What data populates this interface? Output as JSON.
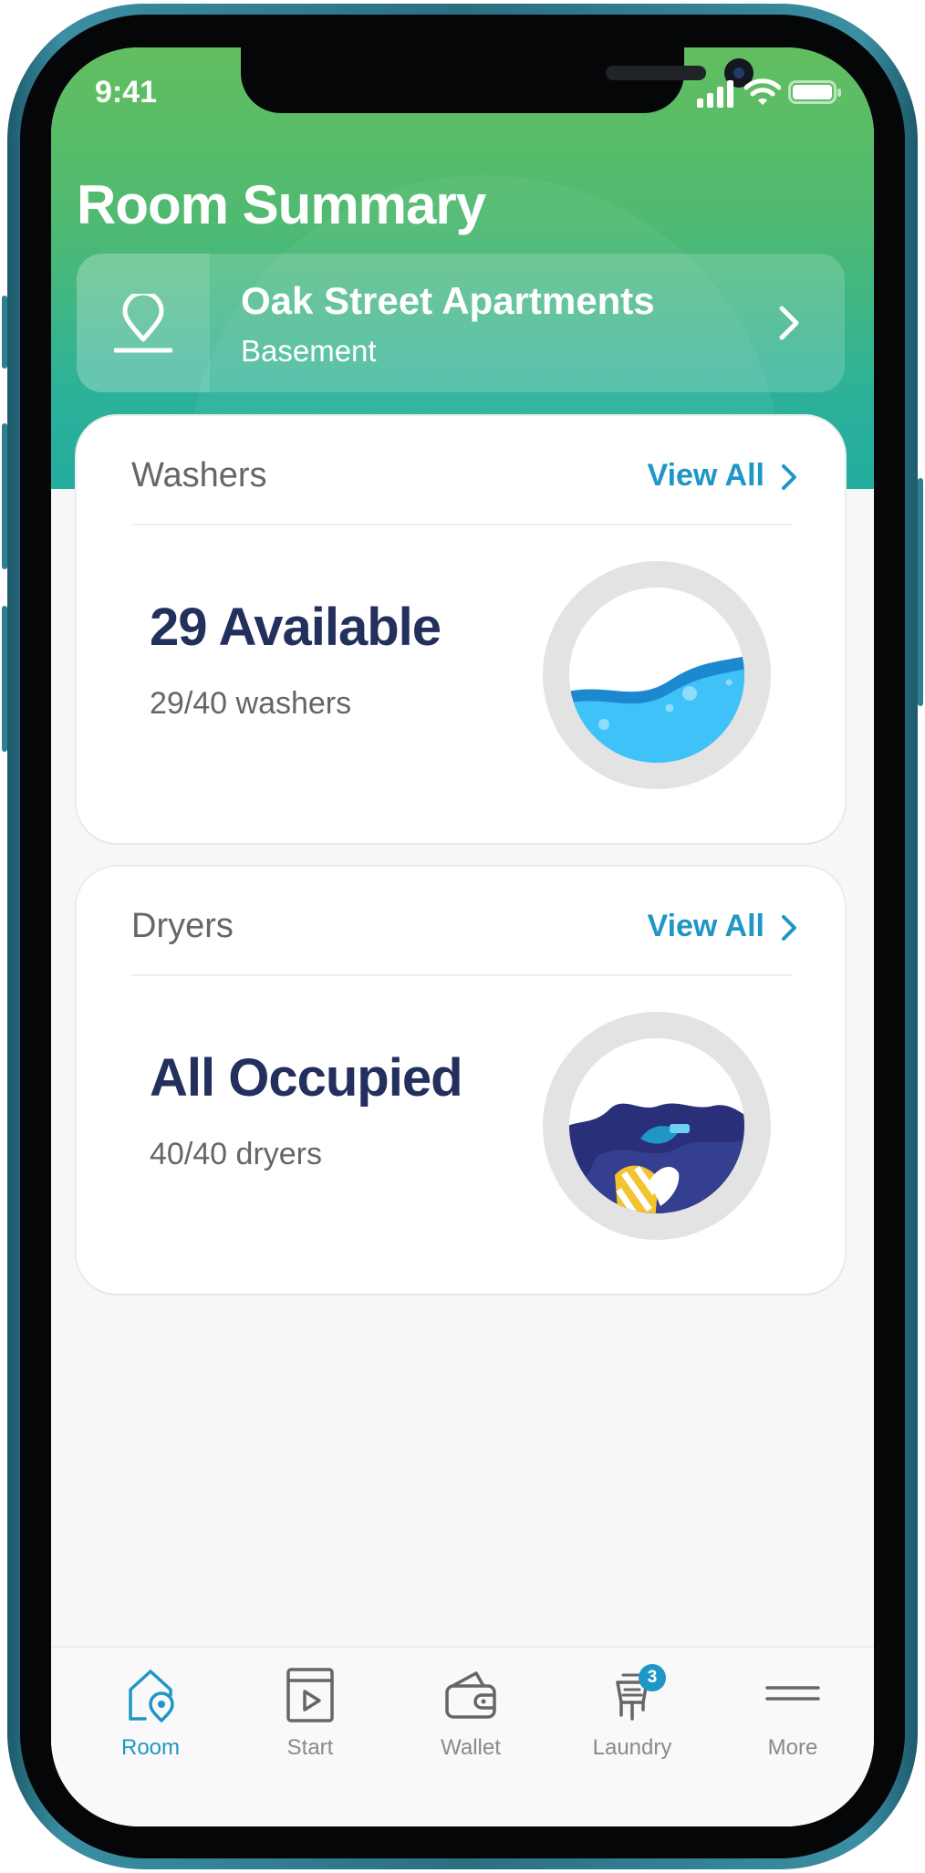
{
  "status_bar": {
    "time": "9:41"
  },
  "header": {
    "title": "Room Summary",
    "location": {
      "name": "Oak Street Apartments",
      "area": "Basement"
    }
  },
  "washers": {
    "title": "Washers",
    "view_all": "View All",
    "headline": "29 Available",
    "detail": "29/40 washers",
    "available": 29,
    "total": 40,
    "illustration": "washer-water-drum"
  },
  "dryers": {
    "title": "Dryers",
    "view_all": "View All",
    "headline": "All Occupied",
    "detail": "40/40 dryers",
    "occupied": 40,
    "total": 40,
    "illustration": "dryer-clothes-drum"
  },
  "tabbar": {
    "items": [
      {
        "label": "Room",
        "icon": "house-pin-icon",
        "active": true
      },
      {
        "label": "Start",
        "icon": "machine-play-icon",
        "active": false
      },
      {
        "label": "Wallet",
        "icon": "wallet-icon",
        "active": false
      },
      {
        "label": "Laundry",
        "icon": "laundry-basket-icon",
        "active": false,
        "badge": "3"
      },
      {
        "label": "More",
        "icon": "menu-icon",
        "active": false
      }
    ]
  },
  "colors": {
    "header_green": "#62be5f",
    "header_teal": "#23ad9f",
    "accent_blue": "#1f97c6",
    "headline_navy": "#23305e",
    "water_blue": "#3fc2f7"
  }
}
